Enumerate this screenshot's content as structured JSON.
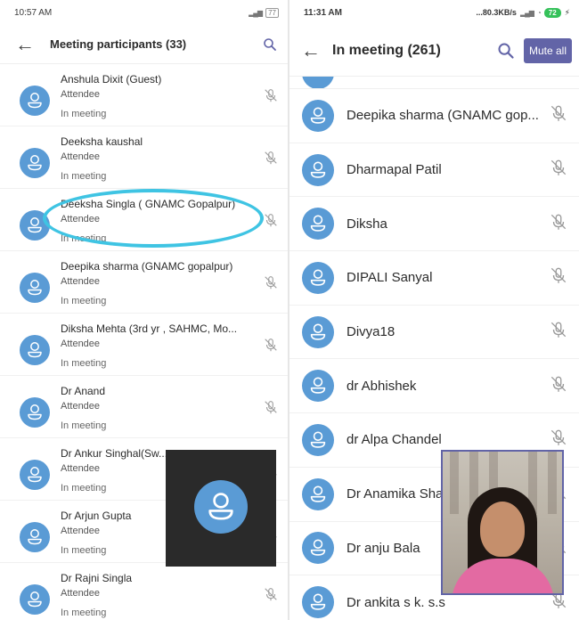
{
  "left": {
    "status_time": "10:57 AM",
    "status_battery": "77",
    "title": "Meeting participants (33)",
    "participants": [
      {
        "name": "Anshula Dixit (Guest)",
        "role": "Attendee",
        "status": "In meeting"
      },
      {
        "name": "Deeksha kaushal",
        "role": "Attendee",
        "status": "In meeting"
      },
      {
        "name": "Deeksha Singla ( GNAMC Gopalpur)",
        "role": "Attendee",
        "status": "In meeting"
      },
      {
        "name": "Deepika sharma (GNAMC gopalpur)",
        "role": "Attendee",
        "status": "In meeting"
      },
      {
        "name": "Diksha Mehta (3rd yr , SAHMC, Mo...",
        "role": "Attendee",
        "status": "In meeting"
      },
      {
        "name": "Dr Anand",
        "role": "Attendee",
        "status": "In meeting"
      },
      {
        "name": "Dr Ankur Singhal(Sw...",
        "role": "Attendee",
        "status": "In meeting"
      },
      {
        "name": "Dr Arjun Gupta",
        "role": "Attendee",
        "status": "In meeting"
      },
      {
        "name": "Dr Rajni Singla",
        "role": "Attendee",
        "status": "In meeting"
      }
    ]
  },
  "right": {
    "status_time": "11:31 AM",
    "status_speed": "...80.3KB/s",
    "status_battery": "72",
    "title": "In meeting (261)",
    "mute_all_label": "Mute all",
    "participants": [
      {
        "name": "Deepika sharma (GNAMC gop..."
      },
      {
        "name": "Dharmapal Patil"
      },
      {
        "name": "Diksha"
      },
      {
        "name": "DIPALI Sanyal"
      },
      {
        "name": "Divya18"
      },
      {
        "name": "dr Abhishek"
      },
      {
        "name": "dr Alpa Chandel"
      },
      {
        "name": "Dr Anamika Sha"
      },
      {
        "name": "Dr anju Bala"
      },
      {
        "name": "Dr ankita s k. s.s"
      }
    ]
  },
  "colors": {
    "avatar": "#5a9bd5",
    "accent": "#6264a7",
    "highlight": "#3fc4e3"
  },
  "icons": {
    "back": "arrow-left-icon",
    "search": "search-icon",
    "mic_off": "mic-off-icon",
    "person": "person-icon"
  }
}
